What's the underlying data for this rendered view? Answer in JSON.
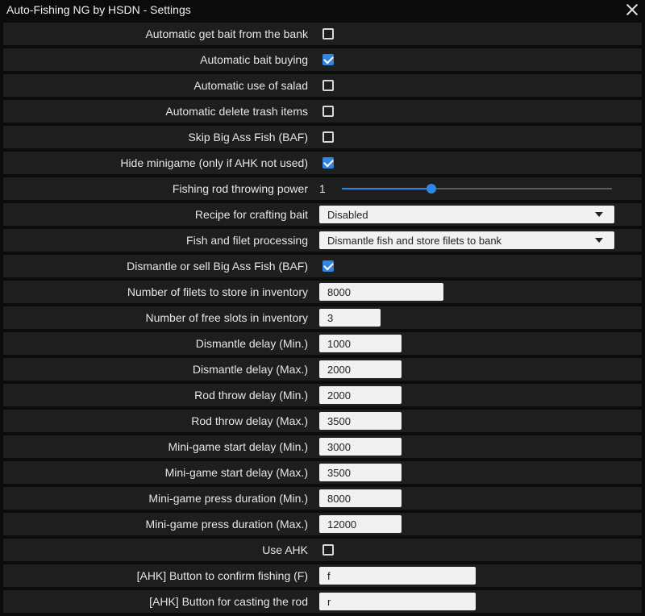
{
  "window": {
    "title": "Auto-Fishing NG by HSDN - Settings"
  },
  "accent_color": "#2e87e6",
  "rows": [
    {
      "label": "Automatic get bait from the bank",
      "type": "checkbox",
      "checked": false
    },
    {
      "label": "Automatic bait buying",
      "type": "checkbox",
      "checked": true
    },
    {
      "label": "Automatic use of salad",
      "type": "checkbox",
      "checked": false
    },
    {
      "label": "Automatic delete trash items",
      "type": "checkbox",
      "checked": false
    },
    {
      "label": "Skip Big Ass Fish (BAF)",
      "type": "checkbox",
      "checked": false
    },
    {
      "label": "Hide minigame (only if AHK not used)",
      "type": "checkbox",
      "checked": true
    },
    {
      "label": "Fishing rod throwing power",
      "type": "slider",
      "value": "1",
      "level": 0.33
    },
    {
      "label": "Recipe for crafting bait",
      "type": "select",
      "value": "Disabled"
    },
    {
      "label": "Fish and filet processing",
      "type": "select",
      "value": "Dismantle fish and store filets to bank"
    },
    {
      "label": "Dismantle or sell Big Ass Fish (BAF)",
      "type": "checkbox",
      "checked": true
    },
    {
      "label": "Number of filets to store in inventory",
      "type": "input",
      "value": "8000"
    },
    {
      "label": "Number of free slots in inventory",
      "type": "input",
      "value": "3"
    },
    {
      "label": "Dismantle delay (Min.)",
      "type": "input",
      "value": "1000"
    },
    {
      "label": "Dismantle delay (Max.)",
      "type": "input",
      "value": "2000"
    },
    {
      "label": "Rod throw delay (Min.)",
      "type": "input",
      "value": "2000"
    },
    {
      "label": "Rod throw delay (Max.)",
      "type": "input",
      "value": "3500"
    },
    {
      "label": "Mini-game start delay (Min.)",
      "type": "input",
      "value": "3000"
    },
    {
      "label": "Mini-game start delay (Max.)",
      "type": "input",
      "value": "3500"
    },
    {
      "label": "Mini-game press duration (Min.)",
      "type": "input",
      "value": "8000"
    },
    {
      "label": "Mini-game press duration (Max.)",
      "type": "input",
      "value": "12000"
    },
    {
      "label": "Use AHK",
      "type": "checkbox",
      "checked": false
    },
    {
      "label": "[AHK] Button to confirm fishing (F)",
      "type": "input",
      "value": "f"
    },
    {
      "label": "[AHK] Button for casting the rod",
      "type": "input",
      "value": "r"
    }
  ]
}
